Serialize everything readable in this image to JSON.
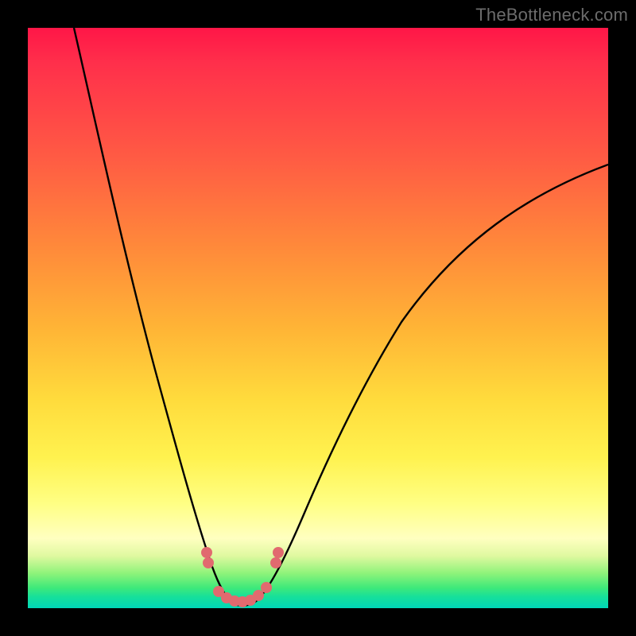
{
  "watermark": "TheBottleneck.com",
  "chart_data": {
    "type": "line",
    "title": "",
    "xlabel": "",
    "ylabel": "",
    "xlim": [
      0,
      100
    ],
    "ylim": [
      0,
      100
    ],
    "grid": false,
    "legend": false,
    "series": [
      {
        "name": "bottleneck-curve",
        "x": [
          1,
          4,
          8,
          12,
          16,
          20,
          24,
          28,
          30,
          32,
          33,
          34,
          35,
          36,
          37,
          38,
          40,
          44,
          50,
          56,
          62,
          70,
          80,
          90,
          100
        ],
        "y": [
          100,
          92,
          82,
          72,
          62,
          52,
          42,
          30,
          22,
          14,
          9,
          5,
          2,
          1,
          2,
          5,
          10,
          20,
          32,
          42,
          50,
          58,
          66,
          72,
          76
        ]
      },
      {
        "name": "highlight-dots",
        "x": [
          30.5,
          30.7,
          32.5,
          33.5,
          34.5,
          35.5,
          36.5,
          37.5,
          38.5,
          40,
          40.3
        ],
        "y": [
          11,
          9,
          2.5,
          1.5,
          1.2,
          1.2,
          1.2,
          1.5,
          2.5,
          9,
          11
        ]
      }
    ],
    "colors": {
      "curve": "#000000",
      "dots": "#e16a6f",
      "gradient_top": "#ff1647",
      "gradient_bottom": "#00d7b8"
    }
  }
}
